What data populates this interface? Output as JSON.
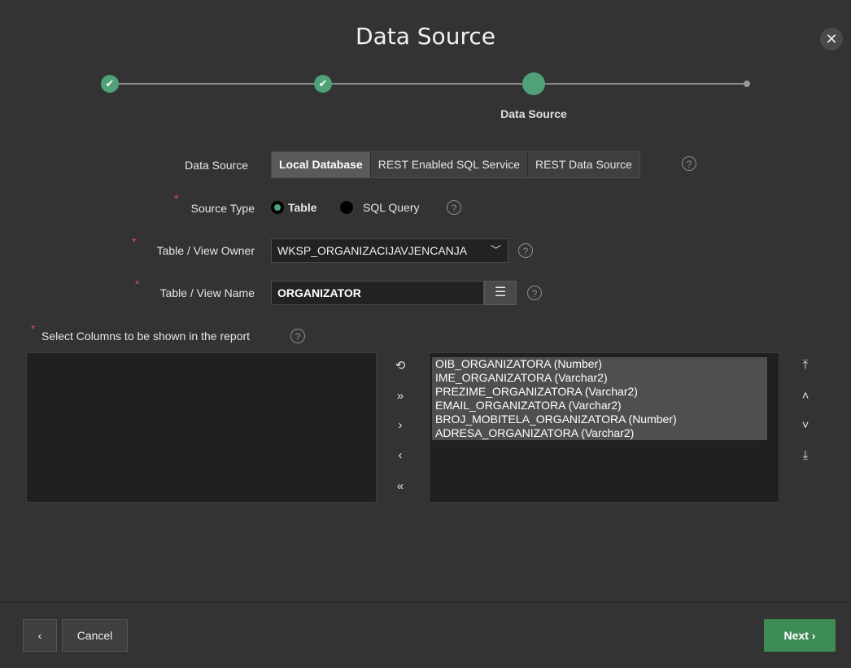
{
  "dialog": {
    "title": "Data Source"
  },
  "wizard": {
    "current_step_label": "Data Source"
  },
  "form": {
    "data_source": {
      "label": "Data Source",
      "options": [
        "Local Database",
        "REST Enabled SQL Service",
        "REST Data Source"
      ],
      "selected": "Local Database"
    },
    "source_type": {
      "label": "Source Type",
      "options": [
        "Table",
        "SQL Query"
      ],
      "selected": "Table"
    },
    "table_owner": {
      "label": "Table / View Owner",
      "value": "WKSP_ORGANIZACIJAVJENCANJA"
    },
    "table_name": {
      "label": "Table / View Name",
      "value": "ORGANIZATOR"
    },
    "columns": {
      "label": "Select Columns to be shown in the report",
      "available": [],
      "selected": [
        "OIB_ORGANIZATORA (Number)",
        "IME_ORGANIZATORA (Varchar2)",
        "PREZIME_ORGANIZATORA (Varchar2)",
        "EMAIL_ORGANIZATORA (Varchar2)",
        "BROJ_MOBITELA_ORGANIZATORA (Number)",
        "ADRESA_ORGANIZATORA (Varchar2)"
      ]
    }
  },
  "footer": {
    "cancel_label": "Cancel",
    "next_label": "Next"
  },
  "icons": {
    "close": "close-icon",
    "check": "check-icon",
    "help": "help-icon",
    "list": "list-icon"
  },
  "colors": {
    "accent": "#4fa277",
    "next_button": "#3e8c55",
    "required": "#e04a4a"
  }
}
